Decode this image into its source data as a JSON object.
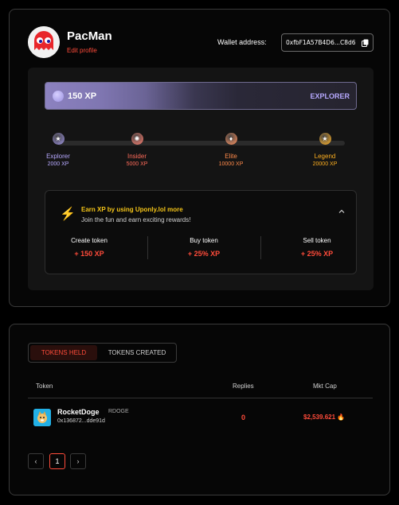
{
  "profile": {
    "username": "PacMan",
    "edit_label": "Edit profile",
    "wallet_label": "Wallet address:",
    "wallet_address": "0xfbF1A57B4D6...C8d6"
  },
  "xp": {
    "current": "150 XP",
    "rank": "EXPLORER",
    "progress_fraction": 0,
    "tiers": [
      {
        "name": "Explorer",
        "xp": "2000 XP",
        "color": "#b7a9ff",
        "dot": "#9a8fe0"
      },
      {
        "name": "Insider",
        "xp": "5000 XP",
        "color": "#ff6b5a",
        "dot": "#ff7a6a"
      },
      {
        "name": "Elite",
        "xp": "10000 XP",
        "color": "#ff8a4a",
        "dot": "#ff8f5a"
      },
      {
        "name": "Legend",
        "xp": "20000 XP",
        "color": "#ffb020",
        "dot": "#ffb020"
      }
    ]
  },
  "earn": {
    "title": "Earn XP by using Uponly.lol more",
    "subtitle": "Join the fun and earn exciting rewards!",
    "items": [
      {
        "label": "Create token",
        "value": "+ 150 XP"
      },
      {
        "label": "Buy token",
        "value": "+ 25% XP"
      },
      {
        "label": "Sell token",
        "value": "+ 25% XP"
      }
    ]
  },
  "tokens": {
    "tabs": [
      "TOKENS HELD",
      "TOKENS CREATED"
    ],
    "columns": [
      "Token",
      "Replies",
      "Mkt Cap"
    ],
    "rows": [
      {
        "name": "RocketDoge",
        "ticker": "RDOGE",
        "address": "0x136872...dde91d",
        "replies": "0",
        "mkt_cap": "$2,539.621"
      }
    ],
    "pagination": {
      "prev": "‹",
      "current": "1",
      "next": "›"
    }
  },
  "colors": {
    "accent": "#ff4b3a",
    "xp_purple": "#8c82c0",
    "gold": "#f5c518"
  }
}
